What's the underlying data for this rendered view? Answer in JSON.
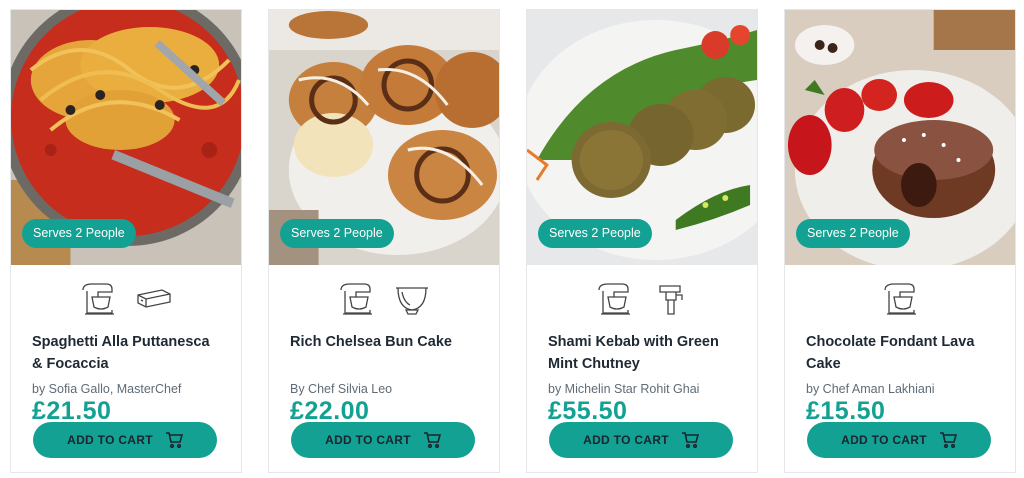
{
  "cart_label": "ADD TO CART",
  "brand_color": "#12a192",
  "recipes": [
    {
      "image": "spaghetti-puttanesca-photo",
      "serves": "Serves 2 People",
      "appliances": [
        "stand-mixer-icon",
        "pasta-attachment-icon"
      ],
      "title": "Spaghetti Alla Puttanesca & Focaccia",
      "author": "by Sofia Gallo, MasterChef",
      "price": "£21.50"
    },
    {
      "image": "chelsea-bun-photo",
      "serves": "Serves 2 People",
      "appliances": [
        "stand-mixer-icon",
        "mixing-bowl-icon"
      ],
      "title": "Rich Chelsea Bun Cake",
      "author": "By Chef Silvia Leo",
      "price": "£22.00"
    },
    {
      "image": "shami-kebab-photo",
      "serves": "Serves 2 People",
      "appliances": [
        "stand-mixer-icon",
        "meat-grinder-icon"
      ],
      "title": "Shami Kebab with Green Mint Chutney",
      "author": "by Michelin Star Rohit Ghai",
      "price": "£55.50"
    },
    {
      "image": "chocolate-fondant-photo",
      "serves": "Serves 2 People",
      "appliances": [
        "stand-mixer-icon"
      ],
      "title": "Chocolate Fondant Lava Cake",
      "author": "by Chef Aman Lakhiani",
      "price": "£15.50"
    }
  ]
}
